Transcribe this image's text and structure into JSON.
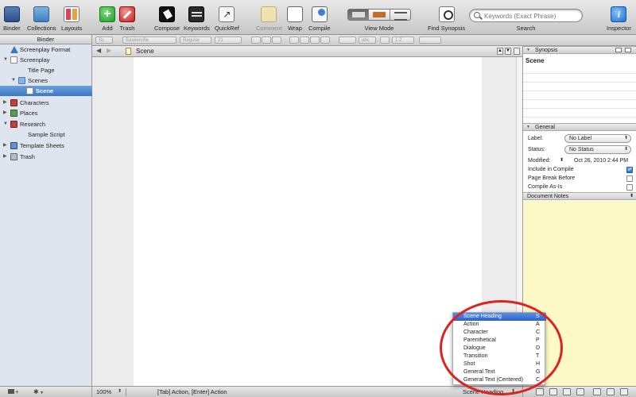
{
  "toolbar": {
    "binder": "Binder",
    "collections": "Collections",
    "layouts": "Layouts",
    "add": "Add",
    "trash": "Trash",
    "compose": "Compose",
    "keywords": "Keywords",
    "quickref": "QuickRef",
    "comment": "Comment",
    "wrap": "Wrap",
    "compile": "Compile",
    "view_mode": "View Mode",
    "find_synopsis": "Find Synopsis",
    "search_placeholder": "Keywords (Exact Phrase)",
    "search_label": "Search",
    "inspector": "Inspector"
  },
  "formatbar": {
    "style": "Sc",
    "font": "Baskerville",
    "weight": "Regular",
    "size": "21",
    "highlight": "abc",
    "spacing": "1.2"
  },
  "binder": {
    "header": "Binder",
    "items": [
      {
        "label": "Screenplay Format",
        "icon": "warning-icon"
      },
      {
        "label": "Screenplay",
        "icon": "document-icon"
      },
      {
        "label": "Title Page",
        "icon": "none"
      },
      {
        "label": "Scenes",
        "icon": "folder-icon"
      },
      {
        "label": "Scene",
        "icon": "document-icon"
      },
      {
        "label": "Characters",
        "icon": "characters-icon"
      },
      {
        "label": "Places",
        "icon": "map-icon"
      },
      {
        "label": "Research",
        "icon": "research-icon"
      },
      {
        "label": "Sample Script",
        "icon": "none"
      },
      {
        "label": "Template Sheets",
        "icon": "grid-icon"
      },
      {
        "label": "Trash",
        "icon": "trash-icon"
      }
    ],
    "footer_add": "+",
    "footer_gear": "✱"
  },
  "editor": {
    "title": "Scene",
    "zoom": "100%",
    "hint": "[Tab] Action, [Enter] Action",
    "element": "Scene Heading"
  },
  "inspector": {
    "synopsis_header": "Synopsis",
    "synopsis_title": "Scene",
    "general_header": "General",
    "label_key": "Label:",
    "label_value": "No Label",
    "status_key": "Status:",
    "status_value": "No Status",
    "modified_key": "Modified:",
    "modified_value": "Oct 26, 2010 2:44 PM",
    "include_compile": "Include in Compile",
    "page_break": "Page Break Before",
    "compile_as_is": "Compile As-Is",
    "notes_header": "Document Notes"
  },
  "popup_menu": {
    "items": [
      {
        "label": "Scene Heading",
        "key": "S",
        "checked": true
      },
      {
        "label": "Action",
        "key": "A"
      },
      {
        "label": "Character",
        "key": "C"
      },
      {
        "label": "Parenthetical",
        "key": "P"
      },
      {
        "label": "Dialogue",
        "key": "D"
      },
      {
        "label": "Transition",
        "key": "T"
      },
      {
        "label": "Shot",
        "key": "H"
      },
      {
        "label": "General Text",
        "key": "G"
      },
      {
        "label": "General Text (Centered)",
        "key": "C"
      }
    ]
  },
  "colors": {
    "selection": "#3c78c4",
    "highlight_circle": "#dd2222",
    "notes_bg": "#fdf9c6"
  }
}
